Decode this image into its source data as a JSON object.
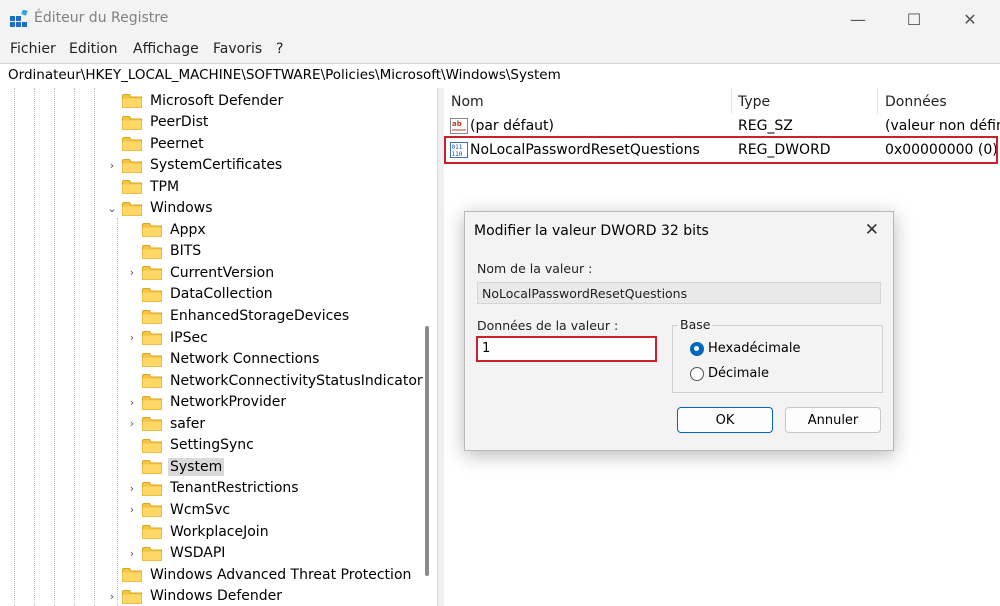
{
  "window": {
    "title": "Éditeur du Registre",
    "icon": "registry-editor-icon"
  },
  "controls": {
    "minimize": "—",
    "maximize": "☐",
    "close": "✕"
  },
  "menu": [
    "Fichier",
    "Edition",
    "Affichage",
    "Favoris",
    "?"
  ],
  "address": "Ordinateur\\HKEY_LOCAL_MACHINE\\SOFTWARE\\Policies\\Microsoft\\Windows\\System",
  "tree": [
    {
      "label": "Microsoft Defender",
      "chevron": ""
    },
    {
      "label": "PeerDist",
      "chevron": ""
    },
    {
      "label": "Peernet",
      "chevron": ""
    },
    {
      "label": "SystemCertificates",
      "chevron": "›"
    },
    {
      "label": "TPM",
      "chevron": ""
    },
    {
      "label": "Windows",
      "chevron": "⌄"
    },
    {
      "label": "Appx",
      "chevron": ""
    },
    {
      "label": "BITS",
      "chevron": ""
    },
    {
      "label": "CurrentVersion",
      "chevron": "›"
    },
    {
      "label": "DataCollection",
      "chevron": ""
    },
    {
      "label": "EnhancedStorageDevices",
      "chevron": ""
    },
    {
      "label": "IPSec",
      "chevron": "›"
    },
    {
      "label": "Network Connections",
      "chevron": ""
    },
    {
      "label": "NetworkConnectivityStatusIndicator",
      "chevron": ""
    },
    {
      "label": "NetworkProvider",
      "chevron": "›"
    },
    {
      "label": "safer",
      "chevron": "›"
    },
    {
      "label": "SettingSync",
      "chevron": ""
    },
    {
      "label": "System",
      "chevron": ""
    },
    {
      "label": "TenantRestrictions",
      "chevron": "›"
    },
    {
      "label": "WcmSvc",
      "chevron": "›"
    },
    {
      "label": "WorkplaceJoin",
      "chevron": ""
    },
    {
      "label": "WSDAPI",
      "chevron": "›"
    },
    {
      "label": "Windows Advanced Threat Protection",
      "chevron": ""
    },
    {
      "label": "Windows Defender",
      "chevron": "›"
    }
  ],
  "values": {
    "columns": [
      "Nom",
      "Type",
      "Données"
    ],
    "rows": [
      {
        "icon": "string-value-icon",
        "name": "(par défaut)",
        "type": "REG_SZ",
        "data": "(valeur non défini"
      },
      {
        "icon": "dword-value-icon",
        "name": "NoLocalPasswordResetQuestions",
        "type": "REG_DWORD",
        "data": "0x00000000 (0)"
      }
    ]
  },
  "dialog": {
    "title": "Modifier la valeur DWORD 32 bits",
    "name_label": "Nom de la valeur :",
    "name_value": "NoLocalPasswordResetQuestions",
    "data_label": "Données de la valeur :",
    "data_value": "1",
    "base_label": "Base",
    "radio_hex": "Hexadécimale",
    "radio_dec": "Décimale",
    "ok": "OK",
    "cancel": "Annuler"
  },
  "colors": {
    "accent": "#0067c0",
    "highlight_border": "#c8232c",
    "folder": "#f5c542"
  }
}
